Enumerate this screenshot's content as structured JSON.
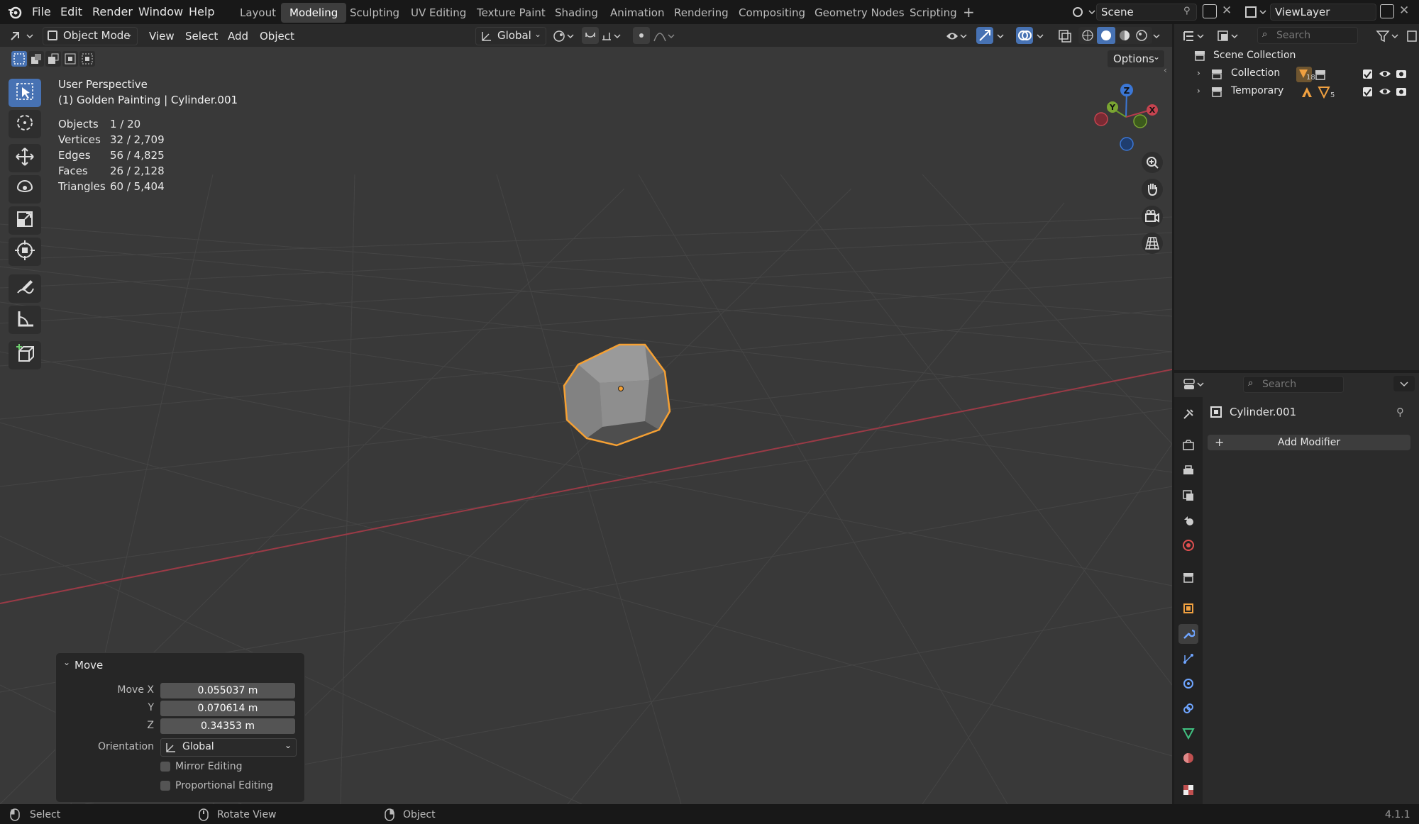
{
  "menu": {
    "file": "File",
    "edit": "Edit",
    "render": "Render",
    "window": "Window",
    "help": "Help"
  },
  "workspaces": [
    "Layout",
    "Modeling",
    "Sculpting",
    "UV Editing",
    "Texture Paint",
    "Shading",
    "Animation",
    "Rendering",
    "Compositing",
    "Geometry Nodes",
    "Scripting"
  ],
  "scene": {
    "name": "Scene",
    "view_layer": "ViewLayer"
  },
  "header": {
    "mode": "Object Mode",
    "view": "View",
    "select": "Select",
    "add": "Add",
    "object": "Object",
    "orientation": "Global",
    "options": "Options"
  },
  "viewport": {
    "perspective": "User Perspective",
    "context": "(1) Golden Painting | Cylinder.001",
    "stats": [
      {
        "label": "Objects",
        "value": "1 / 20"
      },
      {
        "label": "Vertices",
        "value": "32 / 2,709"
      },
      {
        "label": "Edges",
        "value": "56 / 4,825"
      },
      {
        "label": "Faces",
        "value": "26 / 2,128"
      },
      {
        "label": "Triangles",
        "value": "60 / 5,404"
      }
    ],
    "gizmo": {
      "x": "X",
      "y": "Y",
      "z": "Z"
    }
  },
  "move_panel": {
    "title": "Move",
    "move_x_label": "Move X",
    "move_x": "0.055037 m",
    "y_label": "Y",
    "y": "0.070614 m",
    "z_label": "Z",
    "z": "0.34353 m",
    "orientation_label": "Orientation",
    "orientation": "Global",
    "mirror": "Mirror Editing",
    "proportional": "Proportional Editing"
  },
  "outliner": {
    "search_placeholder": "Search",
    "root": "Scene Collection",
    "items": [
      {
        "label": "Collection",
        "count": "18"
      },
      {
        "label": "Temporary",
        "count": "5"
      }
    ]
  },
  "properties": {
    "search_placeholder": "Search",
    "object_name": "Cylinder.001",
    "add_modifier": "Add Modifier"
  },
  "statusbar": {
    "select": "Select",
    "rotate": "Rotate View",
    "object": "Object",
    "version": "4.1.1"
  },
  "colors": {
    "accent": "#4772b3",
    "selection": "#f5a033",
    "x_axis": "#b33b4b",
    "y_axis": "#6b9a2b",
    "z_axis": "#3b77d6"
  }
}
